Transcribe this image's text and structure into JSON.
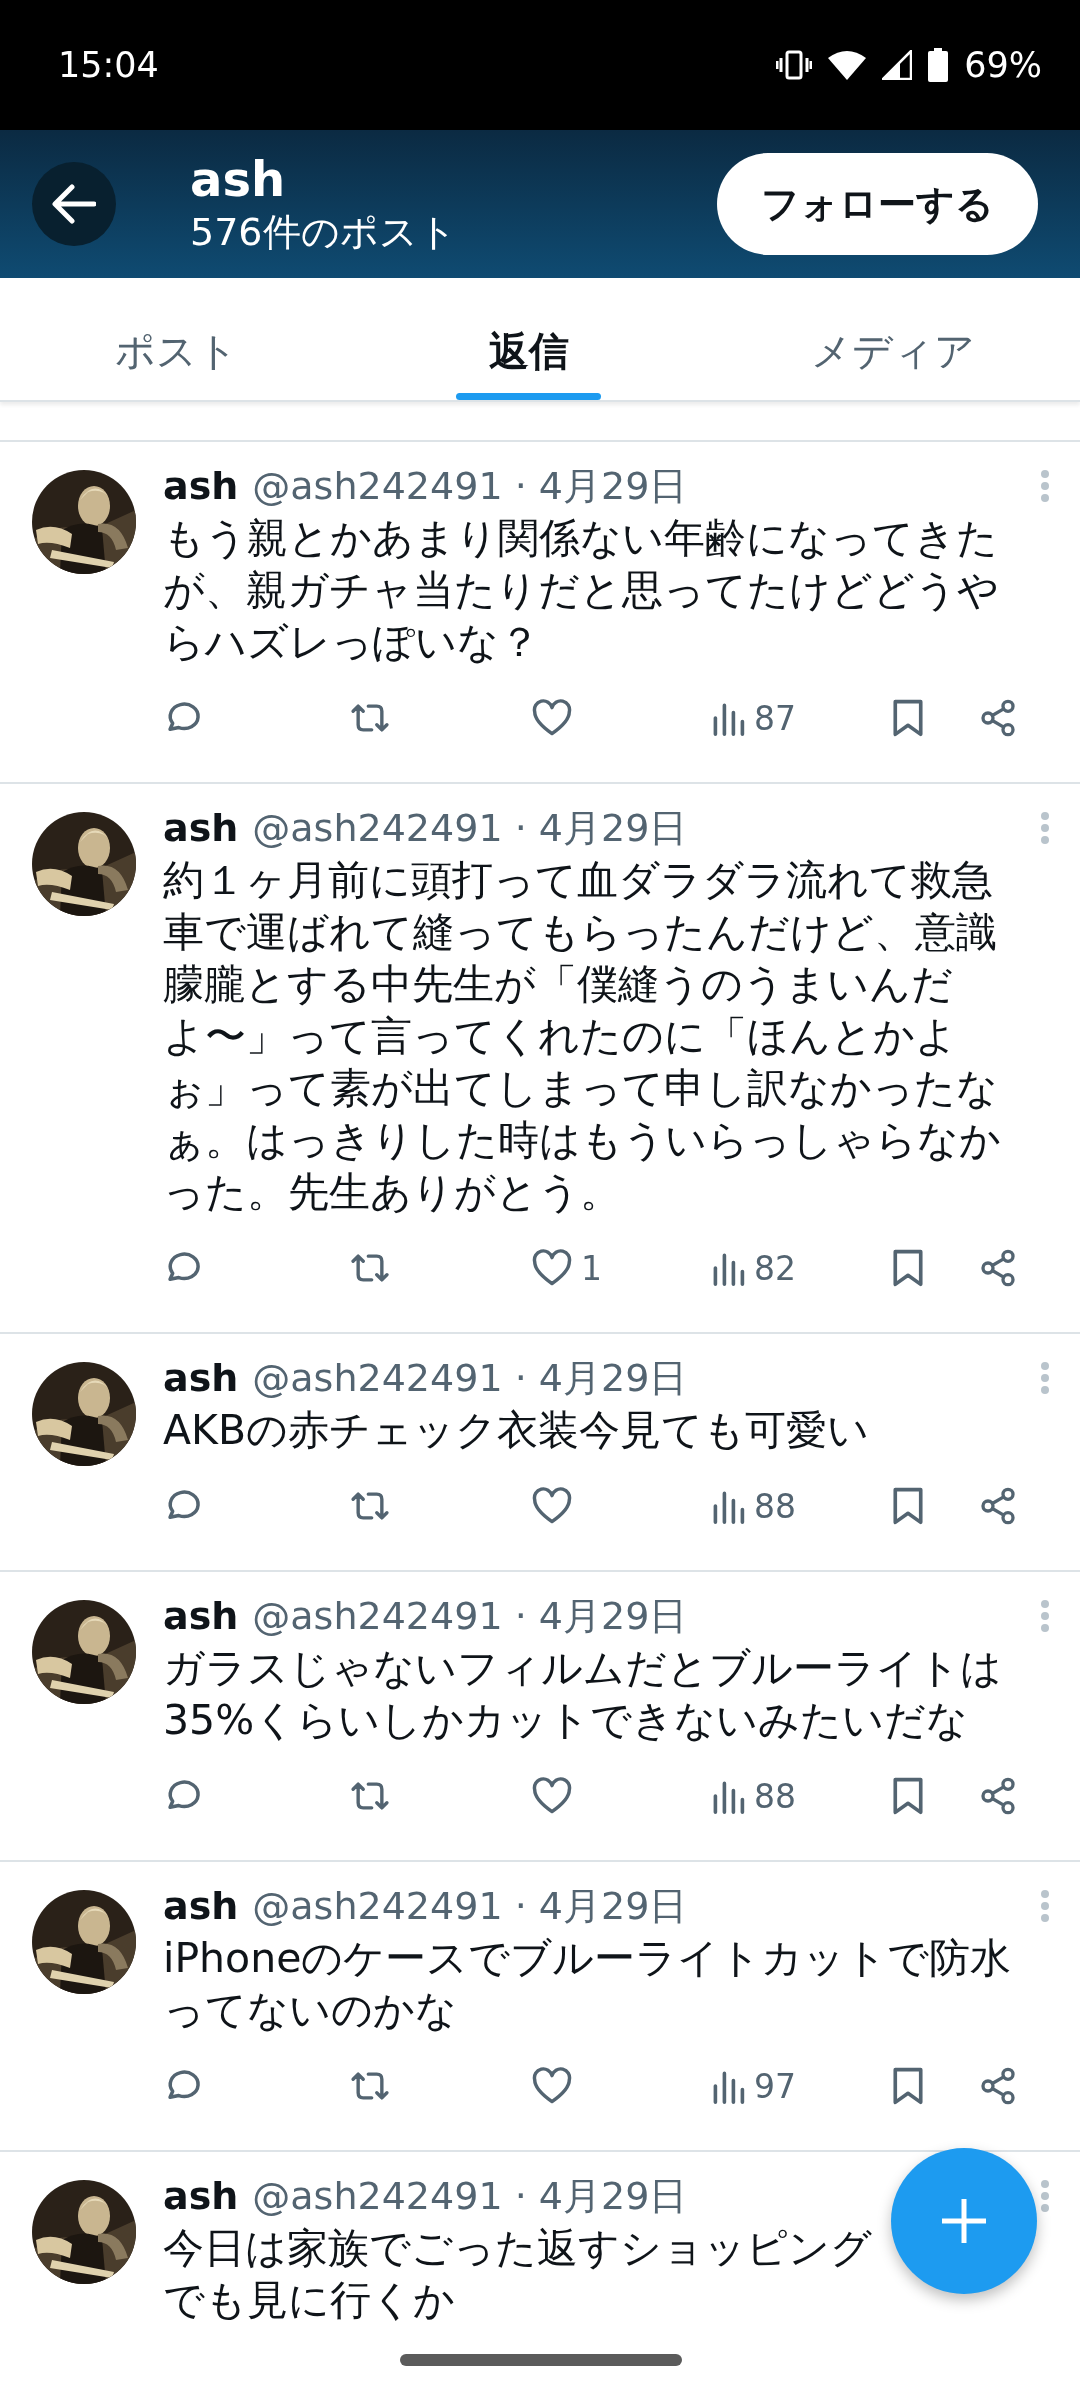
{
  "status_bar": {
    "time": "15:04",
    "battery": "69%"
  },
  "header": {
    "name": "ash",
    "post_count": "576件のポスト",
    "follow_button": "フォローする"
  },
  "tabs": [
    {
      "label": "ポスト",
      "selected": false
    },
    {
      "label": "返信",
      "selected": true
    },
    {
      "label": "メディア",
      "selected": false
    }
  ],
  "posts": [
    {
      "name": "ash",
      "meta": "@ash242491 · 4月29日",
      "text": "もう親とかあまり関係ない年齢になってきたが、親ガチャ当たりだと思ってたけどどうやらハズレっぽいな？",
      "actions": {
        "views": "87"
      }
    },
    {
      "name": "ash",
      "meta": "@ash242491 · 4月29日",
      "text": "約１ヶ月前に頭打って血ダラダラ流れて救急車で運ばれて縫ってもらったんだけど、意識朦朧とする中先生が「僕縫うのうまいんだよ〜」って言ってくれたのに「ほんとかよぉ」って素が出てしまって申し訳なかったなぁ。はっきりした時はもういらっしゃらなかった。先生ありがとう。",
      "actions": {
        "likes": "1",
        "views": "82"
      }
    },
    {
      "name": "ash",
      "meta": "@ash242491 · 4月29日",
      "text": "AKBの赤チェック衣装今見ても可愛い",
      "actions": {
        "views": "88"
      }
    },
    {
      "name": "ash",
      "meta": "@ash242491 · 4月29日",
      "text": "ガラスじゃないフィルムだとブルーライトは35%くらいしかカットできないみたいだな",
      "actions": {
        "views": "88"
      }
    },
    {
      "name": "ash",
      "meta": "@ash242491 · 4月29日",
      "text": "iPhoneのケースでブルーライトカットで防水ってないのかな",
      "actions": {
        "views": "97"
      }
    },
    {
      "name": "ash",
      "meta": "@ash242491 · 4月29日",
      "text": [
        "今日は家族でごった返すショッピング",
        "でも見に行くか"
      ]
    }
  ]
}
